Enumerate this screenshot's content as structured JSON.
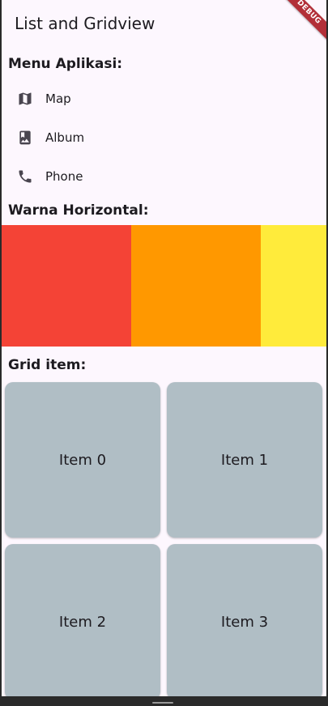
{
  "app": {
    "title": "List and Gridview",
    "debug_banner": "DEBUG"
  },
  "menu_section": {
    "title": "Menu Aplikasi:",
    "items": [
      {
        "icon": "map-icon",
        "label": "Map"
      },
      {
        "icon": "photo-album-icon",
        "label": "Album"
      },
      {
        "icon": "phone-icon",
        "label": "Phone"
      }
    ]
  },
  "color_section": {
    "title": "Warna Horizontal:",
    "colors": [
      "#f44336",
      "#ff9800",
      "#ffeb3b"
    ]
  },
  "grid_section": {
    "title": "Grid item:",
    "items": [
      "Item 0",
      "Item 1",
      "Item 2",
      "Item 3"
    ],
    "item_color": "#b0bec5"
  },
  "theme": {
    "background": "#fdf7fe",
    "text": "#1d1b20",
    "icon": "#49454f"
  }
}
